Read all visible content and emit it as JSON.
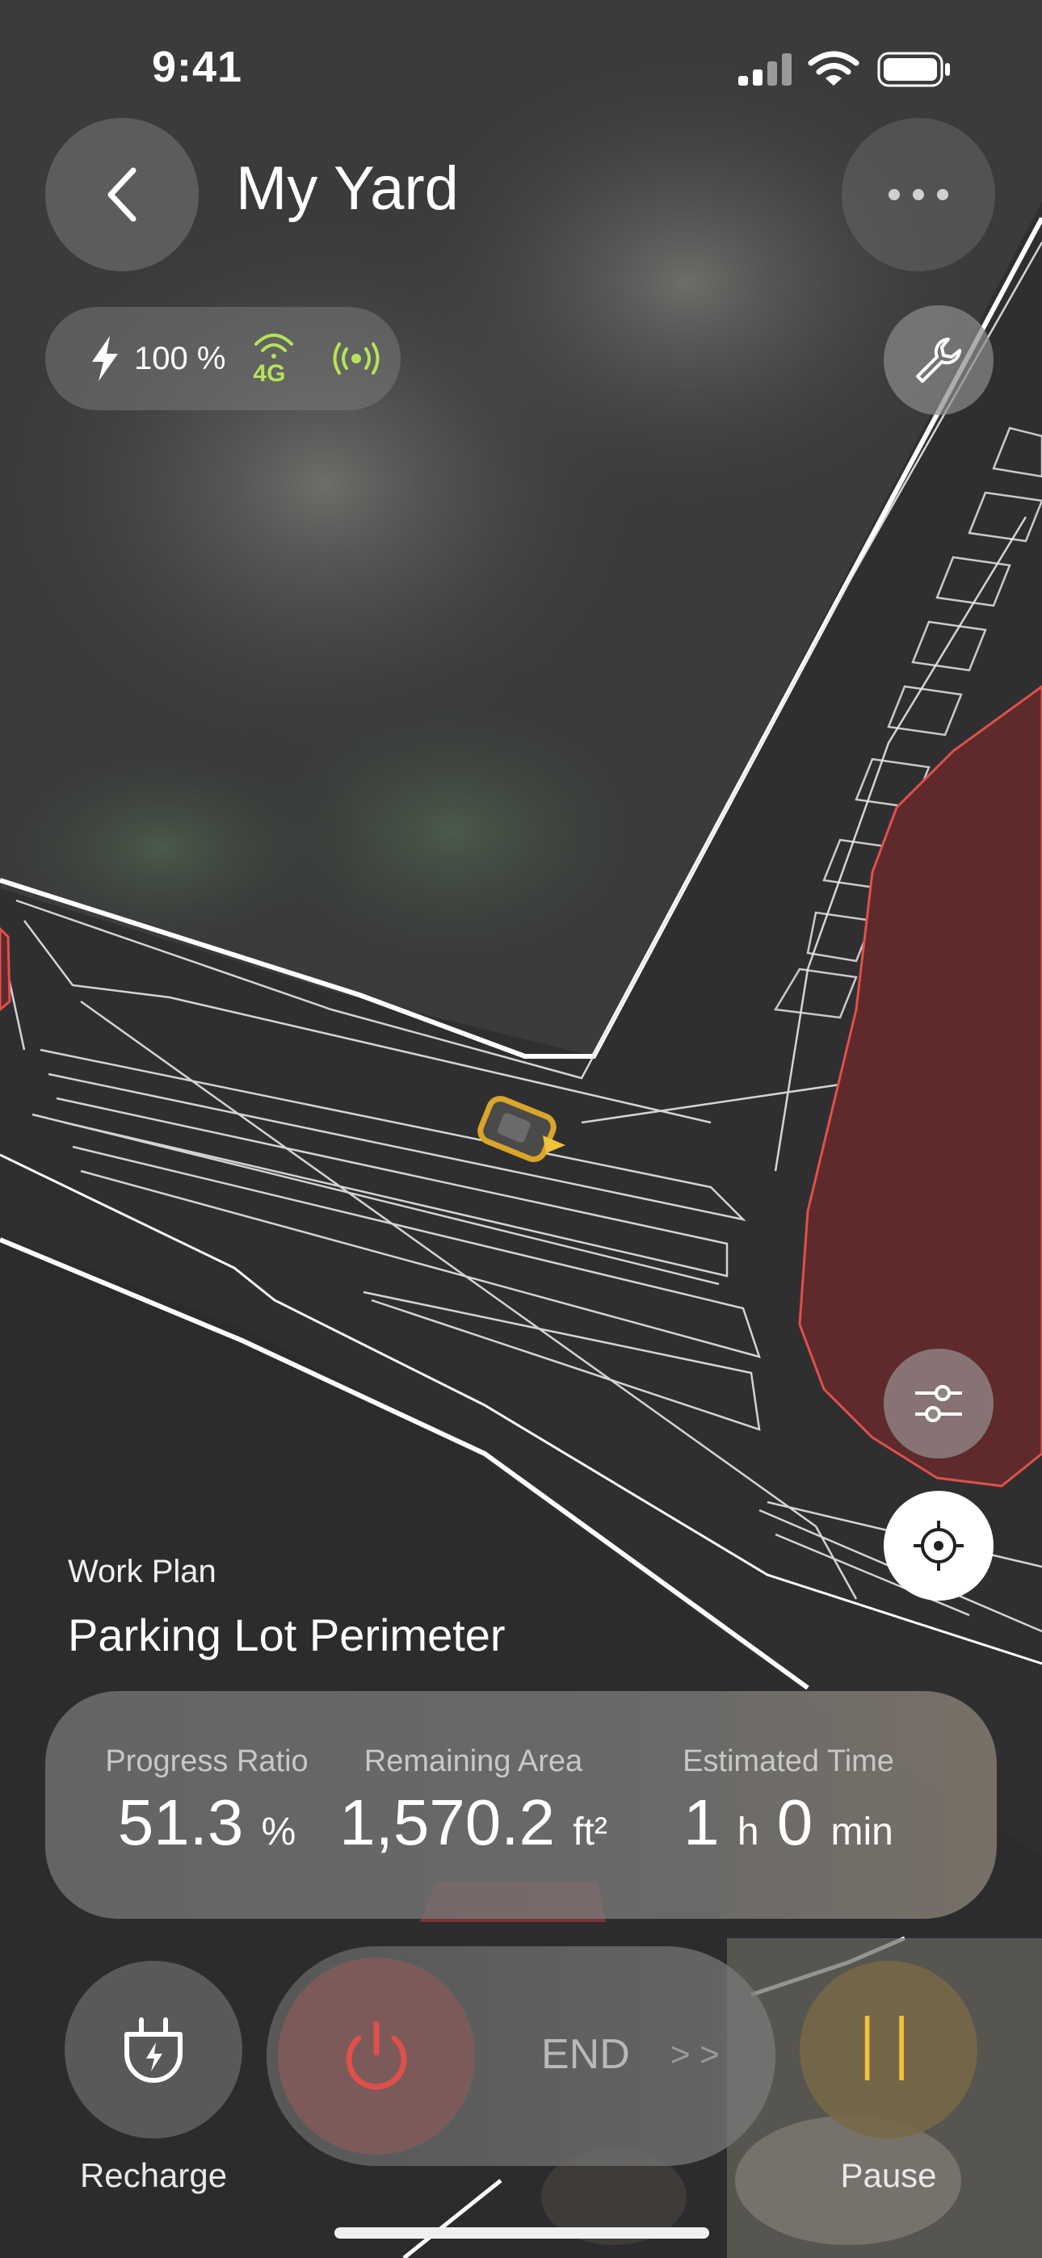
{
  "status_bar": {
    "time": "9:41"
  },
  "header": {
    "title": "My Yard"
  },
  "device": {
    "battery": "100 %",
    "network": "4G"
  },
  "work_plan": {
    "label": "Work Plan",
    "name": "Parking Lot Perimeter"
  },
  "stats": {
    "progress": {
      "label": "Progress Ratio",
      "value": "51.3",
      "unit": "%"
    },
    "remaining": {
      "label": "Remaining Area",
      "value": "1,570.2",
      "unit": "ft²"
    },
    "estimated": {
      "label": "Estimated Time",
      "hours": "1",
      "h_unit": "h",
      "minutes": "0",
      "m_unit": "min"
    }
  },
  "controls": {
    "recharge_label": "Recharge",
    "end_label": "END",
    "end_chevrons": "> >",
    "pause_label": "Pause",
    "pause_glyph": "II"
  },
  "colors": {
    "accent_green": "#b5e35a",
    "pause_yellow": "#f2c23c",
    "power_red": "#e0504a",
    "zone_red": "#5e2a2c"
  }
}
